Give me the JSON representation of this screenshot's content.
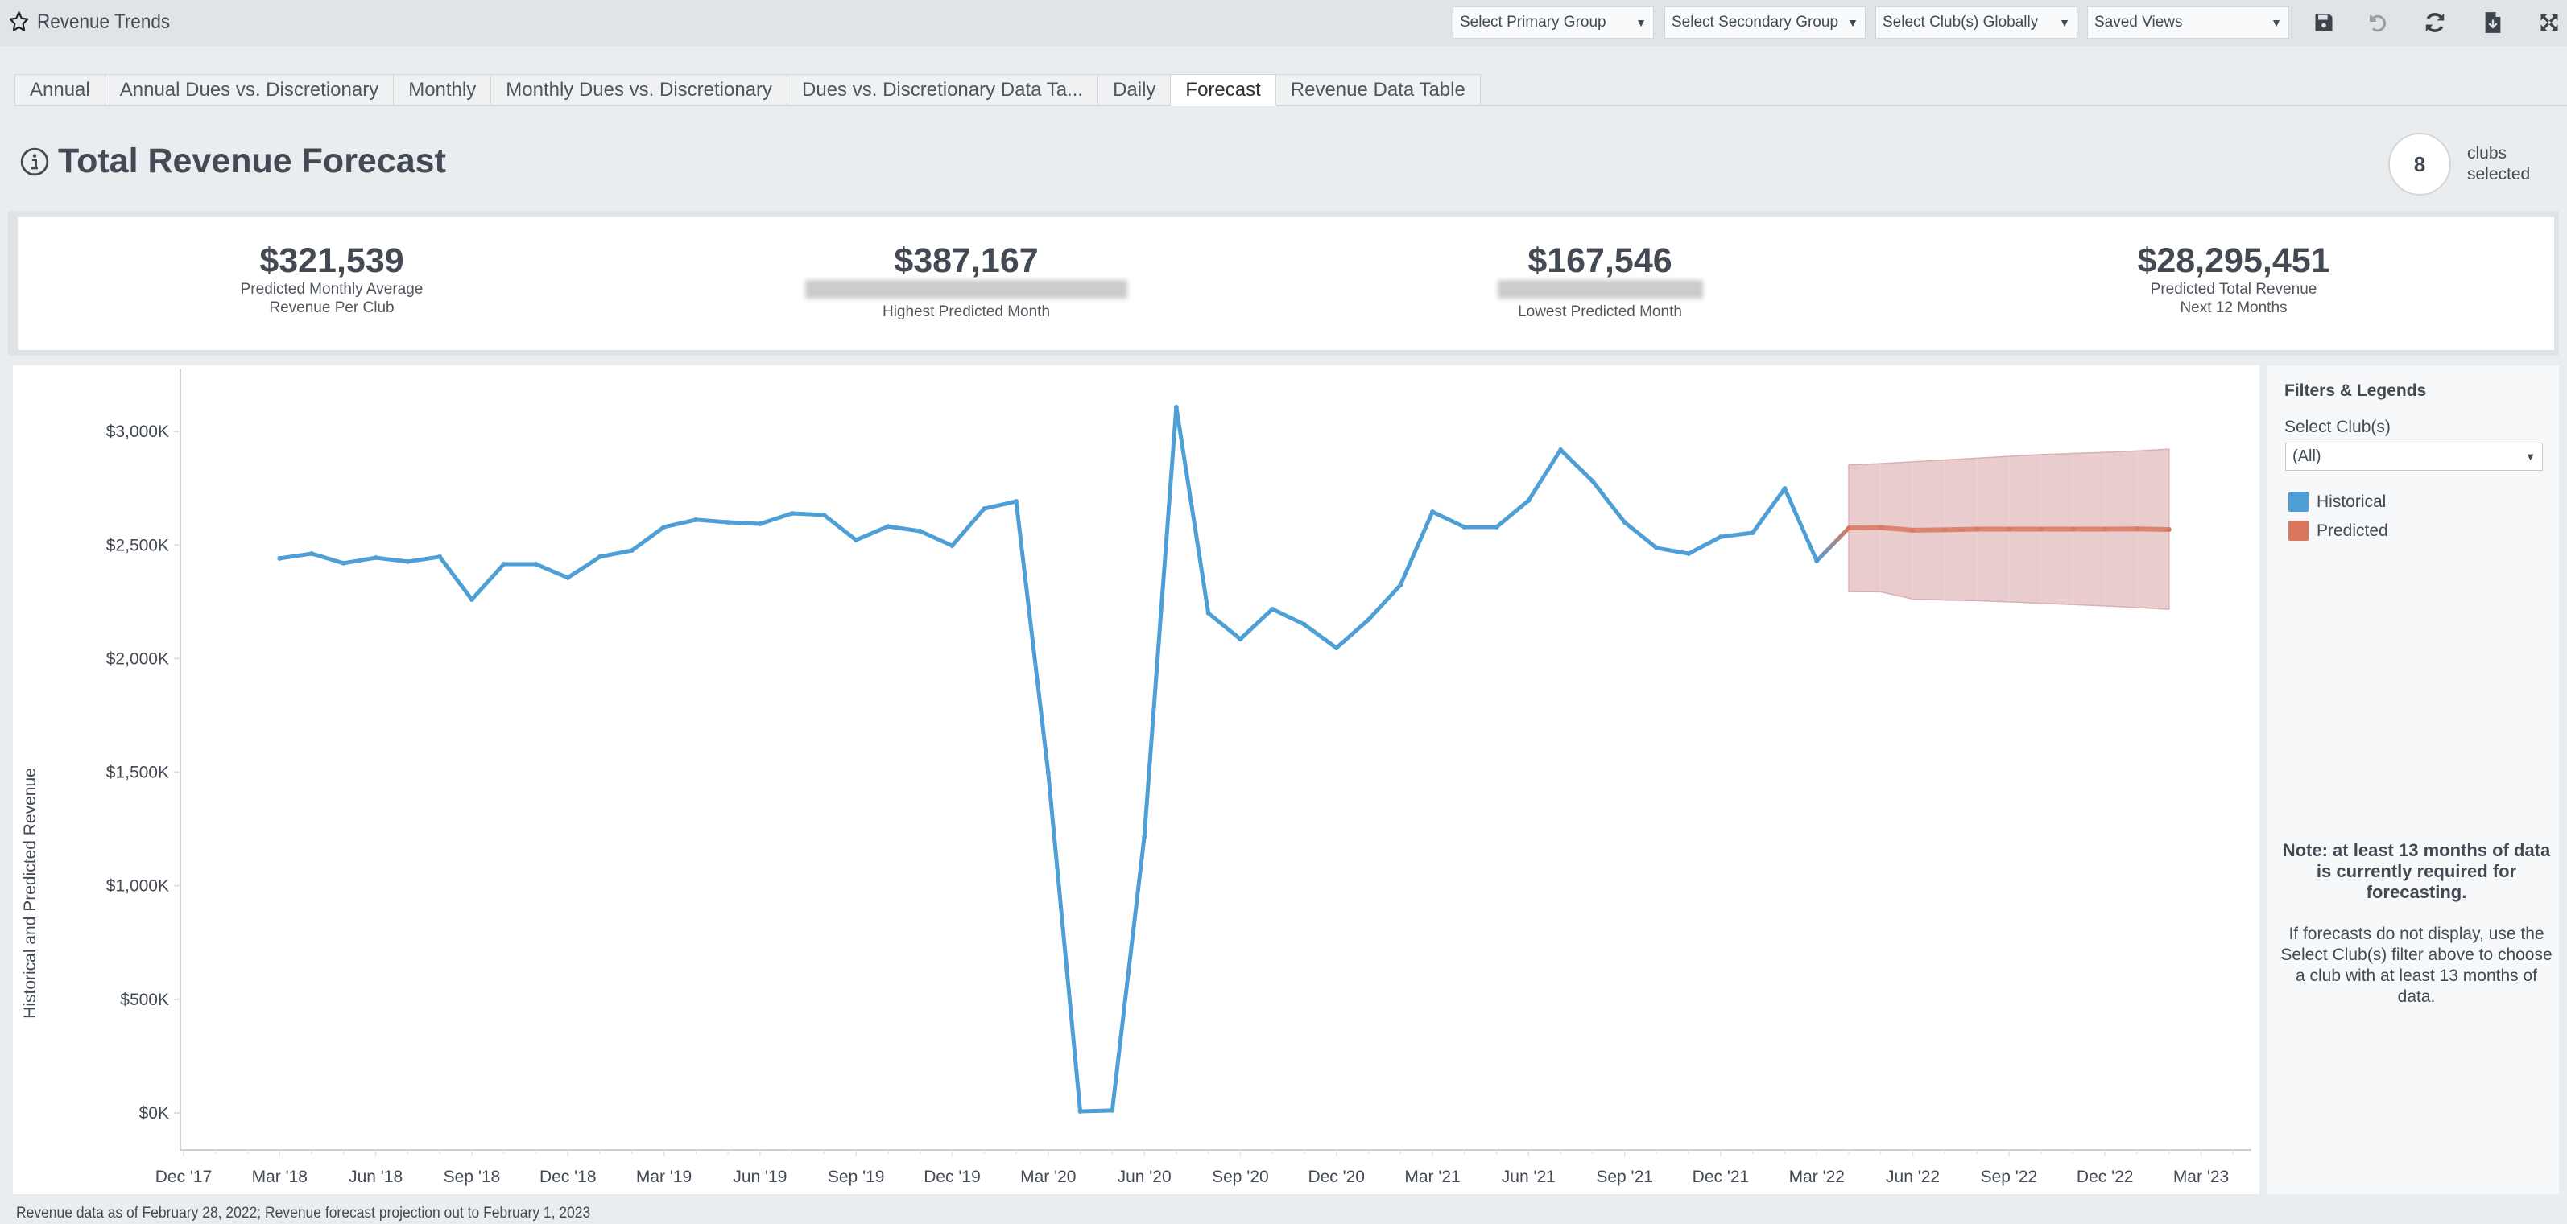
{
  "app": {
    "title": "Revenue Trends",
    "toolbar": {
      "primary_group": "Select Primary Group",
      "secondary_group": "Select Secondary Group",
      "clubs_globally": "Select Club(s) Globally",
      "saved_views": "Saved Views",
      "icons": [
        "save-icon",
        "undo-icon",
        "refresh-icon",
        "download-icon",
        "expand-icon"
      ]
    }
  },
  "tabs": [
    {
      "label": "Annual",
      "active": false
    },
    {
      "label": "Annual Dues vs. Discretionary",
      "active": false
    },
    {
      "label": "Monthly",
      "active": false
    },
    {
      "label": "Monthly Dues vs. Discretionary",
      "active": false
    },
    {
      "label": "Dues vs. Discretionary Data Ta...",
      "active": false
    },
    {
      "label": "Daily",
      "active": false
    },
    {
      "label": "Forecast",
      "active": true
    },
    {
      "label": "Revenue Data Table",
      "active": false
    }
  ],
  "header": {
    "title": "Total Revenue Forecast",
    "clubs_count": "8",
    "clubs_label_1": "clubs",
    "clubs_label_2": "selected"
  },
  "kpis": [
    {
      "value": "$321,539",
      "label_1": "Predicted Monthly Average",
      "label_2": "Revenue Per Club"
    },
    {
      "value": "$387,167",
      "label_1": "[redacted]",
      "label_2": "Highest Predicted Month"
    },
    {
      "value": "$167,546",
      "label_1": "[redacted]",
      "label_2": "Lowest Predicted Month"
    },
    {
      "value": "$28,295,451",
      "label_1": "Predicted Total Revenue",
      "label_2": "Next 12 Months"
    }
  ],
  "side": {
    "title": "Filters & Legends",
    "select_label": "Select Club(s)",
    "select_value": "(All)",
    "legend": [
      {
        "label": "Historical",
        "color": "#4e9fd5"
      },
      {
        "label": "Predicted",
        "color": "#d9775c"
      }
    ],
    "note_bold": "Note: at least 13 months of data is currently required for forecasting.",
    "note_text": "If forecasts do not display, use the Select Club(s) filter above to choose a club with at least 13 months of data."
  },
  "footer": "Revenue data as of February 28, 2022; Revenue forecast projection out to February 1, 2023",
  "chart_data": {
    "type": "line",
    "title": "Total Revenue Forecast",
    "xlabel": "",
    "ylabel": "Historical and Predicted Revenue",
    "y_unit": "$K",
    "ylim": [
      0,
      3200
    ],
    "y_ticks": [
      0,
      500,
      1000,
      1500,
      2000,
      2500,
      3000
    ],
    "y_tick_labels": [
      "$0K",
      "$500K",
      "$1,000K",
      "$1,500K",
      "$2,000K",
      "$2,500K",
      "$3,000K"
    ],
    "x_tick_labels": [
      "Dec '17",
      "Mar '18",
      "Jun '18",
      "Sep '18",
      "Dec '18",
      "Mar '19",
      "Jun '19",
      "Sep '19",
      "Dec '19",
      "Mar '20",
      "Jun '20",
      "Sep '20",
      "Dec '20",
      "Mar '21",
      "Jun '21",
      "Sep '21",
      "Dec '21",
      "Mar '22",
      "Jun '22",
      "Sep '22",
      "Dec '22",
      "Mar '23"
    ],
    "x_start_month": "Dec '17",
    "x_month_count": 65,
    "grid": false,
    "legend_position": "right-panel",
    "series": [
      {
        "name": "Historical",
        "color": "#4e9fd5",
        "start_index": 3,
        "values": [
          2441,
          2462,
          2420,
          2444,
          2427,
          2448,
          2260,
          2416,
          2416,
          2356,
          2448,
          2476,
          2579,
          2611,
          2600,
          2593,
          2639,
          2632,
          2522,
          2582,
          2561,
          2497,
          2660,
          2692,
          1498,
          7,
          11,
          1215,
          3107,
          2200,
          2086,
          2218,
          2150,
          2047,
          2171,
          2324,
          2646,
          2579,
          2579,
          2696,
          2919,
          2781,
          2600,
          2487,
          2462,
          2536,
          2554,
          2749,
          2430
        ]
      },
      {
        "name": "Predicted",
        "color": "#d9775c",
        "start_index": 52,
        "values": [
          2575,
          2577,
          2565,
          2567,
          2570,
          2570,
          2570,
          2570,
          2570,
          2571,
          2568
        ],
        "upper": [
          2852,
          2858,
          2866,
          2874,
          2882,
          2890,
          2898,
          2903,
          2908,
          2914,
          2922
        ],
        "lower": [
          2295,
          2294,
          2262,
          2258,
          2255,
          2250,
          2244,
          2238,
          2232,
          2225,
          2217
        ]
      }
    ]
  }
}
